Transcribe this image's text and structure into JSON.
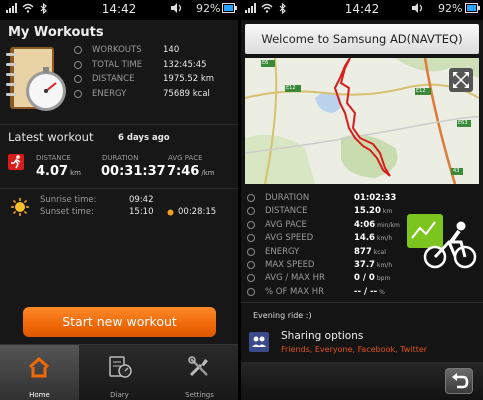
{
  "status_left": {
    "time": "14:42",
    "battery": "92%"
  },
  "status_right": {
    "time": "14:42",
    "battery": "92%"
  },
  "my_workouts": {
    "title": "My Workouts",
    "stats": [
      {
        "label": "WORKOUTS",
        "value": "140",
        "icon": "workouts-icon"
      },
      {
        "label": "TOTAL TIME",
        "value": "132:45:45",
        "icon": "clock-icon"
      },
      {
        "label": "DISTANCE",
        "value": "1975.52 km",
        "icon": "distance-icon"
      },
      {
        "label": "ENERGY",
        "value": "75689 kcal",
        "icon": "energy-icon"
      }
    ]
  },
  "latest": {
    "title": "Latest workout",
    "ago": "6 days ago",
    "distance_label": "DISTANCE",
    "distance_value": "4.07",
    "distance_unit": "km",
    "duration_label": "DURATION",
    "duration_value": "00:31:37",
    "pace_label": "AVG PACE",
    "pace_value": "7:46",
    "pace_unit": "/km"
  },
  "sun": {
    "sunrise_label": "Sunrise time:",
    "sunrise_value": "09:42",
    "sunset_label": "Sunset time:",
    "sunset_value": "15:10",
    "daylight": "00:28:15"
  },
  "start_button": "Start new workout",
  "nav": [
    {
      "label": "Home",
      "icon": "home-icon",
      "active": true
    },
    {
      "label": "Diary",
      "icon": "diary-icon",
      "active": false
    },
    {
      "label": "Settings",
      "icon": "settings-icon",
      "active": false
    }
  ],
  "banner": "Welcome to Samsung AD(NAVTEQ)",
  "map": {
    "road_labels": [
      "E6",
      "E12",
      "E12",
      "E63",
      "43"
    ]
  },
  "workout_detail": [
    {
      "label": "DURATION",
      "value": "01:02:33",
      "unit": ""
    },
    {
      "label": "DISTANCE",
      "value": "15.20",
      "unit": "km"
    },
    {
      "label": "AVG PACE",
      "value": "4:06",
      "unit": "min/km"
    },
    {
      "label": "AVG SPEED",
      "value": "14.6",
      "unit": "km/h"
    },
    {
      "label": "ENERGY",
      "value": "877",
      "unit": "kcal"
    },
    {
      "label": "MAX SPEED",
      "value": "37.7",
      "unit": "km/h"
    },
    {
      "label": "AVG / MAX HR",
      "value": "0 / 0",
      "unit": "bpm"
    },
    {
      "label": "% OF MAX HR",
      "value": "-- / --",
      "unit": "%"
    }
  ],
  "note": "Evening ride :)",
  "sharing": {
    "title": "Sharing options",
    "subtitle": "Friends, Everyone, Facebook, Twitter"
  },
  "colors": {
    "accent_orange": "#f06a0a",
    "route_red": "#d81d1d",
    "activity_green": "#7cc41e",
    "share_text": "#e2541e"
  }
}
